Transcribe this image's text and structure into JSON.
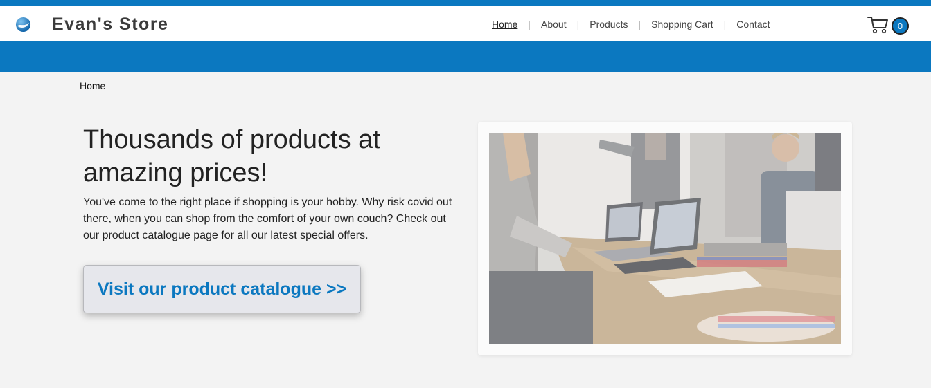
{
  "header": {
    "brand": "Evan's Store",
    "logo_icon": "globe-swirl-icon",
    "nav": [
      {
        "label": "Home",
        "active": true
      },
      {
        "label": "About",
        "active": false
      },
      {
        "label": "Products",
        "active": false
      },
      {
        "label": "Shopping Cart",
        "active": false
      },
      {
        "label": "Contact",
        "active": false
      }
    ],
    "nav_separator": "|",
    "cart_icon": "shopping-cart-icon",
    "cart_count": "0"
  },
  "breadcrumb": "Home",
  "hero": {
    "headline": "Thousands of products at amazing prices!",
    "intro": "You've come to the right place if shopping is your hobby. Why risk covid out there, when you can shop from the comfort of your own couch? Check out our product catalogue page for all our latest special offers.",
    "cta_label": "Visit our product catalogue >>"
  },
  "colors": {
    "brand_blue": "#0b78c0",
    "page_background": "#f3f3f3",
    "cta_background": "#e6e7ec"
  }
}
